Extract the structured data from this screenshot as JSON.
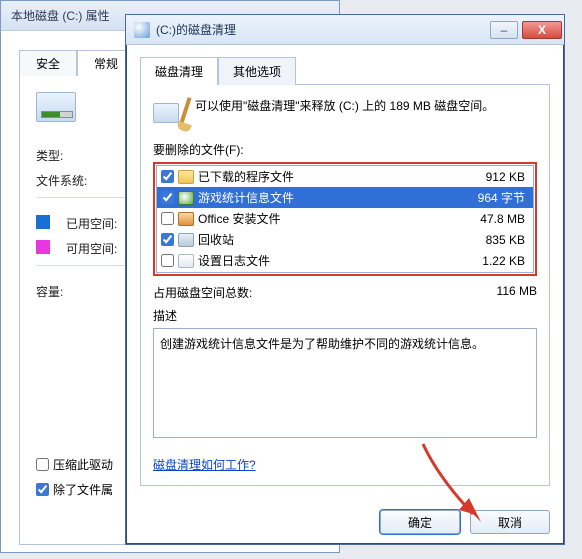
{
  "back_window": {
    "title": "本地磁盘 (C:) 属性",
    "tabs": {
      "security": "安全",
      "general": "常规"
    },
    "type_label": "类型:",
    "fs_label": "文件系统:",
    "used_label": "已用空间:",
    "free_label": "可用空间:",
    "capacity_label": "容量:",
    "compress_label": "压缩此驱动",
    "index_label": "除了文件属"
  },
  "front_window": {
    "title": "(C:)的磁盘清理",
    "tabs": {
      "cleanup": "磁盘清理",
      "other": "其他选项"
    },
    "message": "可以使用\"磁盘清理\"来释放  (C:) 上的 189 MB 磁盘空间。",
    "files_label": "要删除的文件(F):",
    "files": [
      {
        "checked": true,
        "icon": "fi-folder",
        "name": "已下载的程序文件",
        "size": "912 KB"
      },
      {
        "checked": true,
        "icon": "fi-game",
        "name": "游戏统计信息文件",
        "size": "964 字节",
        "selected": true
      },
      {
        "checked": false,
        "icon": "fi-office",
        "name": "Office 安装文件",
        "size": "47.8 MB"
      },
      {
        "checked": true,
        "icon": "fi-bin",
        "name": "回收站",
        "size": "835 KB"
      },
      {
        "checked": false,
        "icon": "fi-log",
        "name": "设置日志文件",
        "size": "1.22 KB"
      }
    ],
    "total_label": "占用磁盘空间总数:",
    "total_value": "116 MB",
    "desc_label": "描述",
    "desc_text": "创建游戏统计信息文件是为了帮助维护不同的游戏统计信息。",
    "help_link": "磁盘清理如何工作?",
    "ok_label": "确定",
    "cancel_label": "取消"
  }
}
